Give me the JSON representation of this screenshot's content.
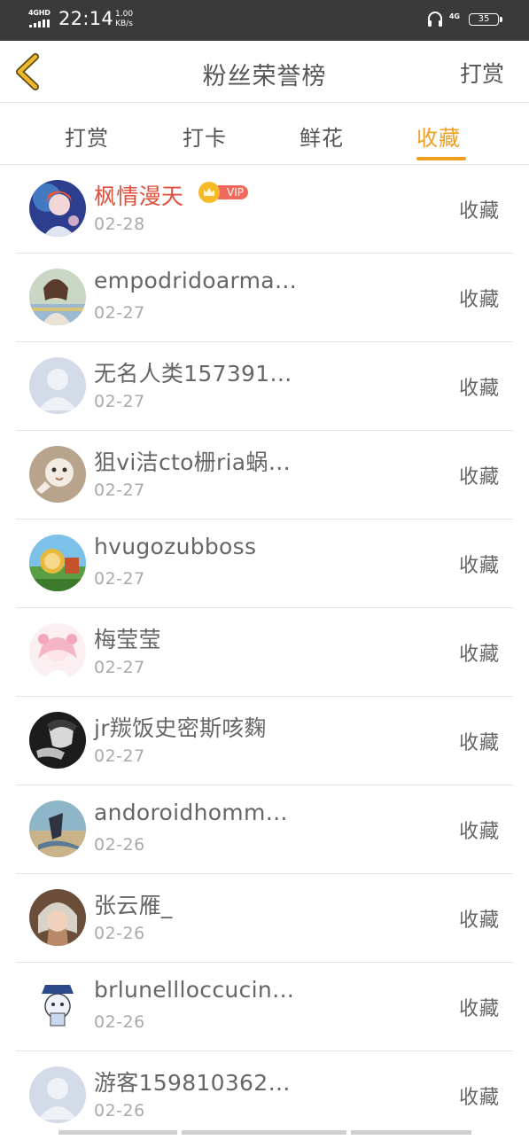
{
  "status_bar": {
    "network": "4GHD",
    "time": "22:14",
    "speed_value": "1.00",
    "speed_unit": "KB/s",
    "network_right": "4G",
    "battery": "35"
  },
  "nav": {
    "back_icon": "chevron-left-icon",
    "title": "粉丝荣誉榜",
    "right_label": "打赏"
  },
  "tabs": [
    {
      "label": "打赏",
      "active": false
    },
    {
      "label": "打卡",
      "active": false
    },
    {
      "label": "鲜花",
      "active": false
    },
    {
      "label": "收藏",
      "active": true
    }
  ],
  "colors": {
    "accent": "#f0a020",
    "vip_name": "#e0503c",
    "vip_pill": "#ef6a5c",
    "status_bar": "#3a3a3a"
  },
  "rows": [
    {
      "name": "枫情漫天",
      "date": "02-28",
      "action": "收藏",
      "vip": true,
      "vip_label": "VIP"
    },
    {
      "name": "empodridoarma…",
      "date": "02-27",
      "action": "收藏"
    },
    {
      "name": "无名人类157391…",
      "date": "02-27",
      "action": "收藏"
    },
    {
      "name": "狙vi洁cto栅ria蜗…",
      "date": "02-27",
      "action": "收藏"
    },
    {
      "name": "hvugozubboss",
      "date": "02-27",
      "action": "收藏"
    },
    {
      "name": "梅莹莹",
      "date": "02-27",
      "action": "收藏"
    },
    {
      "name": "jr羰饭史密斯咳麴",
      "date": "02-27",
      "action": "收藏"
    },
    {
      "name": "andoroidhomm…",
      "date": "02-26",
      "action": "收藏"
    },
    {
      "name": "张云雁_",
      "date": "02-26",
      "action": "收藏"
    },
    {
      "name": "brlunellloccucin…",
      "date": "02-26",
      "action": "收藏"
    },
    {
      "name": "游客159810362…",
      "date": "02-26",
      "action": "收藏"
    }
  ]
}
